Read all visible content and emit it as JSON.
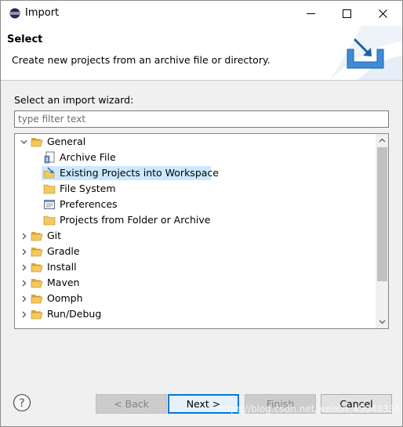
{
  "window": {
    "title": "Import"
  },
  "header": {
    "title": "Select",
    "description": "Create new projects from an archive file or directory."
  },
  "wizard": {
    "prompt": "Select an import wizard:",
    "filter_placeholder": "type filter text",
    "filter_value": ""
  },
  "tree": {
    "general": {
      "label": "General",
      "children": [
        {
          "label": "Archive File",
          "icon": "archive-file-icon"
        },
        {
          "label": "Existing Projects into Workspace",
          "icon": "existing-projects-icon",
          "selected": true
        },
        {
          "label": "File System",
          "icon": "folder-icon"
        },
        {
          "label": "Preferences",
          "icon": "preferences-icon"
        },
        {
          "label": "Projects from Folder or Archive",
          "icon": "folder-icon"
        }
      ]
    },
    "groups": [
      "Git",
      "Gradle",
      "Install",
      "Maven",
      "Oomph",
      "Run/Debug"
    ]
  },
  "buttons": {
    "back": "< Back",
    "next": "Next >",
    "finish": "Finish",
    "cancel": "Cancel",
    "help": "?"
  },
  "watermark": "https://blog.csdn.net/weixin_45048331",
  "colors": {
    "selection": "#cce8ff",
    "default_button_border": "#0078d7",
    "folder": "#e8b54a"
  }
}
